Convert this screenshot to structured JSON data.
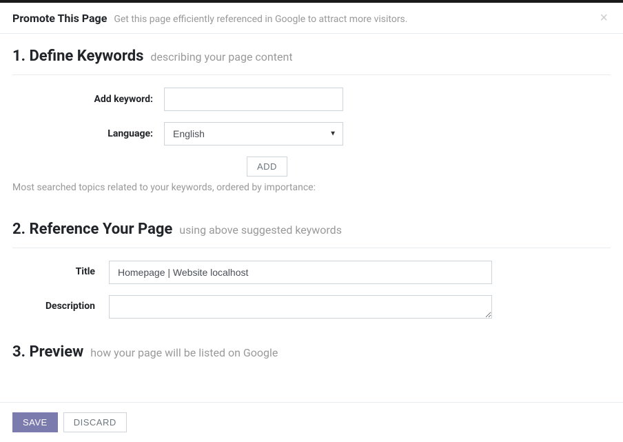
{
  "header": {
    "title": "Promote This Page",
    "subtitle": "Get this page efficiently referenced in Google to attract more visitors.",
    "close_glyph": "×"
  },
  "section1": {
    "title": "1. Define Keywords",
    "subtitle": "describing your page content",
    "keyword_label": "Add keyword:",
    "keyword_value": "",
    "language_label": "Language:",
    "language_value": "English",
    "add_button": "ADD",
    "hint": "Most searched topics related to your keywords, ordered by importance:"
  },
  "section2": {
    "title": "2. Reference Your Page",
    "subtitle": "using above suggested keywords",
    "title_label": "Title",
    "title_value": "Homepage | Website localhost",
    "description_label": "Description",
    "description_value": ""
  },
  "section3": {
    "title": "3. Preview",
    "subtitle": "how your page will be listed on Google"
  },
  "footer": {
    "save": "SAVE",
    "discard": "DISCARD"
  }
}
